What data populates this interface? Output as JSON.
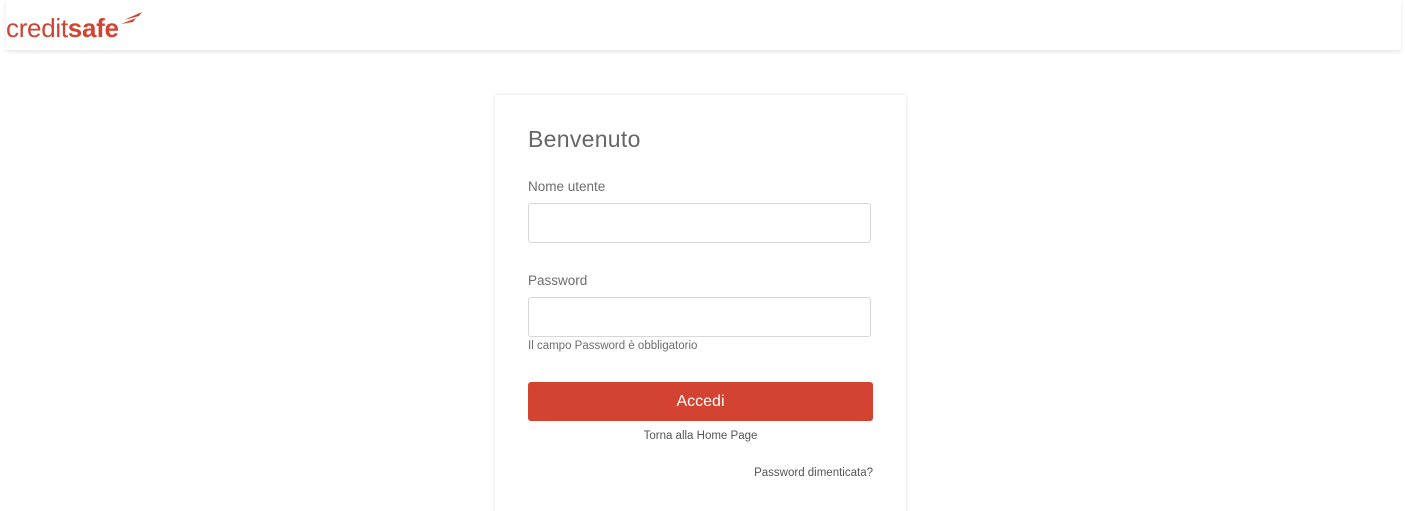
{
  "brand": {
    "logo_light": "credit",
    "logo_bold": "safe",
    "accent_color": "#d24431",
    "logo_mark_icon": "red-swoosh-icon"
  },
  "login": {
    "title": "Benvenuto",
    "username_label": "Nome utente",
    "username_value": "",
    "password_label": "Password",
    "password_value": "",
    "password_error": "Il campo Password è obbligatorio",
    "submit_label": "Accedi",
    "home_link": "Torna alla Home Page",
    "forgot_link": "Password dimenticata?"
  }
}
